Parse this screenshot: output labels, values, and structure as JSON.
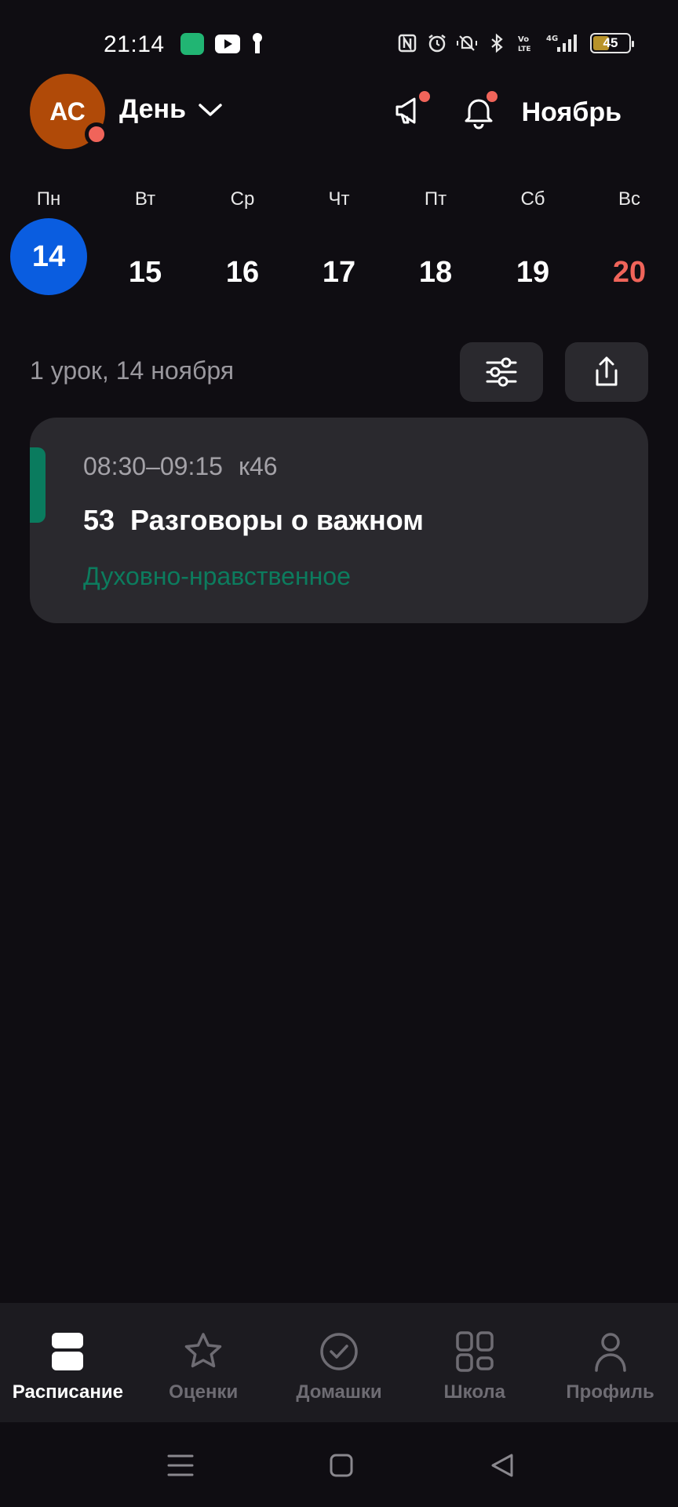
{
  "status_bar": {
    "time": "21:14",
    "left_icons": [
      "chat-app-icon",
      "youtube-icon",
      "keyhole-icon"
    ],
    "right_icons": [
      "nfc-icon",
      "alarm-icon",
      "vibrate-icon",
      "bluetooth-icon",
      "volte-icon",
      "signal-4g-icon"
    ],
    "battery_level": "45",
    "battery_fraction": 0.45
  },
  "header": {
    "avatar_initials": "АС",
    "view_mode": "День",
    "month": "Ноябрь",
    "icons": [
      "megaphone-icon",
      "bell-icon",
      "chevron-down-icon"
    ]
  },
  "week": {
    "days": [
      {
        "name": "Пн",
        "date": "14",
        "selected": true,
        "weekend": false
      },
      {
        "name": "Вт",
        "date": "15",
        "selected": false,
        "weekend": false
      },
      {
        "name": "Ср",
        "date": "16",
        "selected": false,
        "weekend": false
      },
      {
        "name": "Чт",
        "date": "17",
        "selected": false,
        "weekend": false
      },
      {
        "name": "Пт",
        "date": "18",
        "selected": false,
        "weekend": false
      },
      {
        "name": "Сб",
        "date": "19",
        "selected": false,
        "weekend": false
      },
      {
        "name": "Вс",
        "date": "20",
        "selected": false,
        "weekend": true
      }
    ]
  },
  "summary": {
    "text": "1 урок, 14 ноября",
    "icons": [
      "filter-sliders-icon",
      "share-icon"
    ]
  },
  "lessons": [
    {
      "time": "08:30–09:15",
      "room": "к46",
      "number": "53",
      "subject": "Разговоры о важном",
      "category": "Духовно-нравственное"
    }
  ],
  "bottom_nav": {
    "items": [
      {
        "label": "Расписание",
        "icon": "schedule-icon",
        "active": true
      },
      {
        "label": "Оценки",
        "icon": "star-icon",
        "active": false
      },
      {
        "label": "Домашки",
        "icon": "check-circle-icon",
        "active": false
      },
      {
        "label": "Школа",
        "icon": "grid-icon",
        "active": false
      },
      {
        "label": "Профиль",
        "icon": "person-icon",
        "active": false
      }
    ]
  },
  "system_nav": {
    "icons": [
      "menu-icon",
      "home-square-icon",
      "back-triangle-icon"
    ]
  },
  "colors": {
    "background": "#0f0d12",
    "card": "#2a292e",
    "accent_blue": "#0a5de0",
    "weekend_red": "#f0645a",
    "category_green": "#0c7c5e",
    "avatar_bg": "#b04a08"
  }
}
